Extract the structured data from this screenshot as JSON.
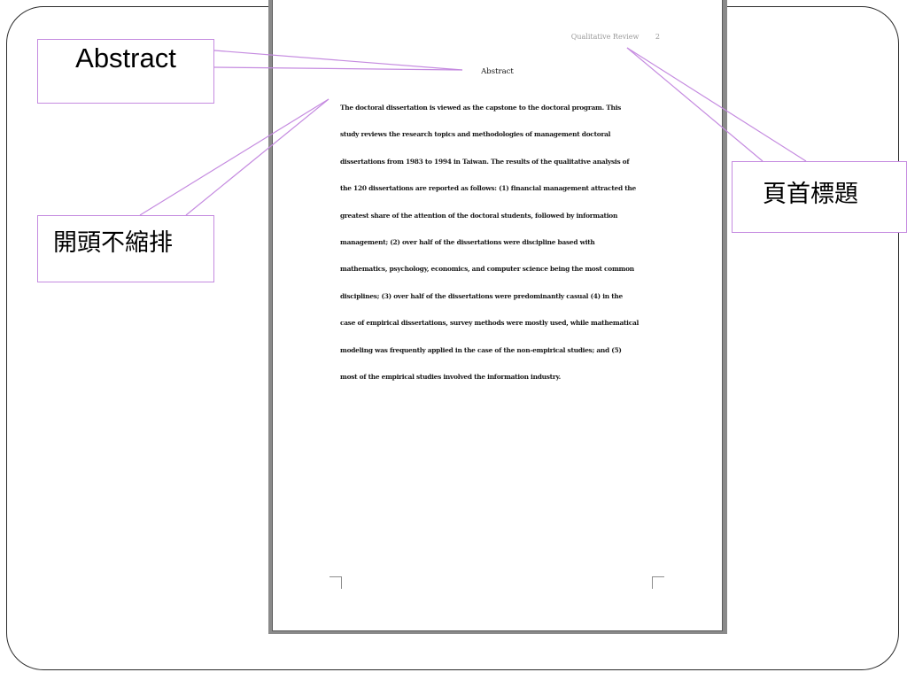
{
  "document": {
    "running_head": "Qualitative Review",
    "page_number": "2",
    "abstract_title": "Abstract",
    "abstract_lines": [
      "The doctoral dissertation is viewed as the capstone to the doctoral program. This",
      "study reviews the research topics and methodologies of management doctoral",
      "dissertations from 1983 to 1994 in Taiwan. The results of the qualitative analysis of",
      "the 120 dissertations are reported as follows: (1) financial management attracted the",
      "greatest share of the attention of the doctoral students, followed by information",
      "management; (2) over half of the dissertations were discipline based with",
      "mathematics, psychology, economics, and computer science being the most common",
      "disciplines; (3) over half of the dissertations were predominantly casual (4) in the",
      "case of empirical dissertations, survey methods were mostly used, while mathematical",
      "modeling was frequently applied in the case of the non-empirical studies; and (5)",
      "most of the empirical studies involved the information industry."
    ]
  },
  "callouts": {
    "abstract_label": "Abstract",
    "no_indent_label": "開頭不縮排",
    "page_header_label": "頁首標題"
  },
  "colors": {
    "callout_border": "#c58be0",
    "leader_line": "#c58be0",
    "frame": "#2b2b2b"
  }
}
